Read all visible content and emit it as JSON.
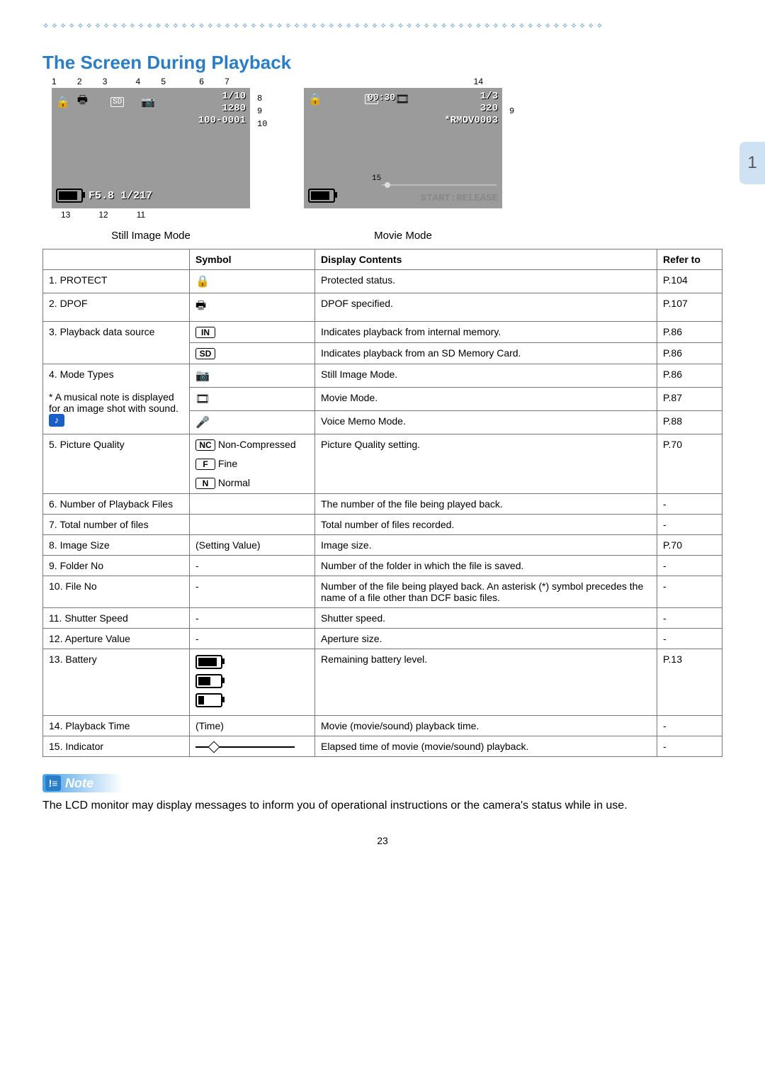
{
  "section_number": "1",
  "title": "The Screen During Playback",
  "page_number": "23",
  "screens": {
    "still": {
      "label": "Still Image Mode",
      "top_callouts": [
        "1",
        "2",
        "3",
        "4",
        "5",
        "6",
        "7"
      ],
      "right_callouts": [
        "8",
        "9",
        "10"
      ],
      "bottom_callouts": [
        "13",
        "12",
        "11"
      ],
      "overlay": {
        "count": "1/10",
        "size": "1280",
        "folder_file": "100-0001",
        "bottom": "F5.8 1/217"
      }
    },
    "movie": {
      "label": "Movie Mode",
      "top_callouts": [
        "14"
      ],
      "right_callouts": [
        "9"
      ],
      "mid_callouts": [
        "15"
      ],
      "overlay": {
        "count": "1/3",
        "size": "320",
        "time": "00:30",
        "file": "*RMOV0003",
        "bottom_right": "START:RELEASE"
      }
    }
  },
  "table": {
    "headers": [
      "",
      "Symbol",
      "Display Contents",
      "Refer to"
    ],
    "footnote": "* A musical note is displayed for an image shot with sound.",
    "rows": [
      {
        "n": "1. PROTECT",
        "sym": "protect",
        "desc": "Protected status.",
        "ref": "P.104"
      },
      {
        "n": "2. DPOF",
        "sym": "dpof",
        "desc": "DPOF specified.",
        "ref": "P.107"
      },
      {
        "n": "3. Playback data source",
        "sym": "IN",
        "desc": "Indicates playback from internal memory.",
        "ref": "P.86"
      },
      {
        "n": "",
        "sym": "SD",
        "desc": "Indicates playback from an SD Memory Card.",
        "ref": "P.86"
      },
      {
        "n": "4. Mode Types",
        "sym": "still",
        "desc": "Still Image Mode.",
        "ref": "P.86"
      },
      {
        "n": "",
        "sym": "movie",
        "desc": "Movie Mode.",
        "ref": "P.87"
      },
      {
        "n": "",
        "sym": "voice",
        "desc": "Voice Memo Mode.",
        "ref": "P.88"
      },
      {
        "n": "5. Picture Quality",
        "sym": "quality",
        "desc": "Picture Quality setting.",
        "ref": "P.70"
      },
      {
        "n": "6. Number of Playback Files",
        "sym": "",
        "desc": "The number of the file being played back.",
        "ref": "-"
      },
      {
        "n": "7. Total number of files",
        "sym": "",
        "desc": "Total number of files recorded.",
        "ref": "-"
      },
      {
        "n": "8. Image Size",
        "sym": "(Setting Value)",
        "desc": "Image size.",
        "ref": "P.70"
      },
      {
        "n": "9. Folder No",
        "sym": "-",
        "desc": "Number of the folder in which the file is saved.",
        "ref": "-"
      },
      {
        "n": "10. File No",
        "sym": "-",
        "desc": "Number of the file being played back. An asterisk (*) symbol precedes the name of a file other than DCF basic files.",
        "ref": "-"
      },
      {
        "n": "11. Shutter Speed",
        "sym": "-",
        "desc": "Shutter speed.",
        "ref": "-"
      },
      {
        "n": "12. Aperture Value",
        "sym": "-",
        "desc": "Aperture size.",
        "ref": "-"
      },
      {
        "n": "13. Battery",
        "sym": "battery",
        "desc": "Remaining battery level.",
        "ref": "P.13"
      },
      {
        "n": "14. Playback Time",
        "sym": "(Time)",
        "desc": "Movie (movie/sound) playback time.",
        "ref": "-"
      },
      {
        "n": "15. Indicator",
        "sym": "indicator",
        "desc": "Elapsed time of movie (movie/sound) playback.",
        "ref": "-"
      }
    ],
    "quality_labels": {
      "nc": "Non-Compressed",
      "fine": "Fine",
      "normal": "Normal"
    }
  },
  "note": {
    "title": "Note",
    "text": "The LCD monitor may display messages to inform you of operational instructions or the camera's status while in use."
  }
}
